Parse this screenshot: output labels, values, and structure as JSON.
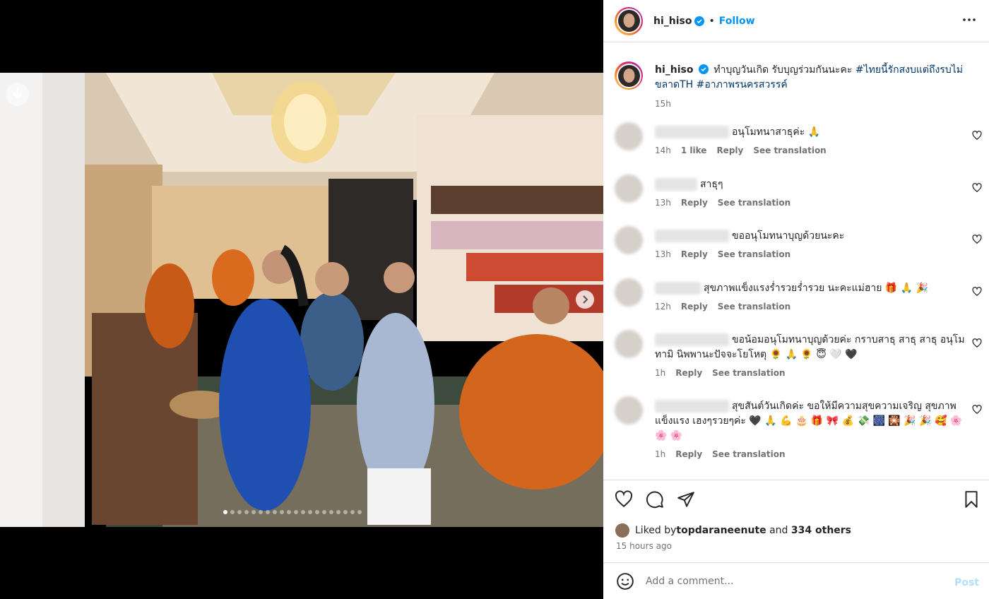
{
  "post": {
    "username": "hi_hiso",
    "follow_label": "Follow",
    "bullet": "•",
    "caption_text": "ทำบุญวันเกิด รับบุญร่วมกันนะคะ ",
    "hashtags": "#ไทยนี้รักสงบแต่ถึงรบไม่ขลาดTH #อาภาพรนครสวรรค์",
    "caption_time": "15h",
    "carousel_dots": 20,
    "active_dot": 0
  },
  "comments": [
    {
      "text": "อนุโมทนาสาธุค่ะ 🙏",
      "time": "14h",
      "likes": "1 like",
      "reply": "Reply",
      "translate": "See translation"
    },
    {
      "text": "สาธุๆ",
      "time": "13h",
      "likes": "",
      "reply": "Reply",
      "translate": "See translation"
    },
    {
      "text": "ขออนุโมทนาบุญด้วยนะคะ",
      "time": "13h",
      "likes": "",
      "reply": "Reply",
      "translate": "See translation"
    },
    {
      "text": "สุขภาพแข็งแรงร่ำรวยร่ำรวย นะคะแม่ฮาย 🎁 🙏 🎉",
      "time": "12h",
      "likes": "",
      "reply": "Reply",
      "translate": "See translation"
    },
    {
      "text": "ขอน้อมอนุโมทนาบุญด้วยค่ะ กราบสาธุ สาธุ สาธุ อนุโมทามิ นิพพานะปัจจะโยโหตุ 🌻 🙏 🌻 😇 🤍 🖤",
      "time": "1h",
      "likes": "",
      "reply": "Reply",
      "translate": "See translation"
    },
    {
      "text": "สุขสันต์วันเกิดค่ะ ขอให้มีความสุขความเจริญ สุขภาพแข็งแรง เฮงๆรวยๆค่ะ 🖤 🙏 💪 🎂 🎁 🎀 💰 💸 🎆 🎇 🎉 🎉 🥰 🌸 🌸 🌸",
      "time": "1h",
      "likes": "",
      "reply": "Reply",
      "translate": "See translation"
    }
  ],
  "likes": {
    "prefix": "Liked by ",
    "user": "topdaraneenute",
    "middle": " and ",
    "others": "334 others",
    "time_ago": "15 hours ago"
  },
  "composer": {
    "placeholder": "Add a comment...",
    "post_label": "Post"
  },
  "colors": {
    "link_blue": "#0095f6",
    "hashtag": "#00376b",
    "verified": "#0095f6"
  }
}
